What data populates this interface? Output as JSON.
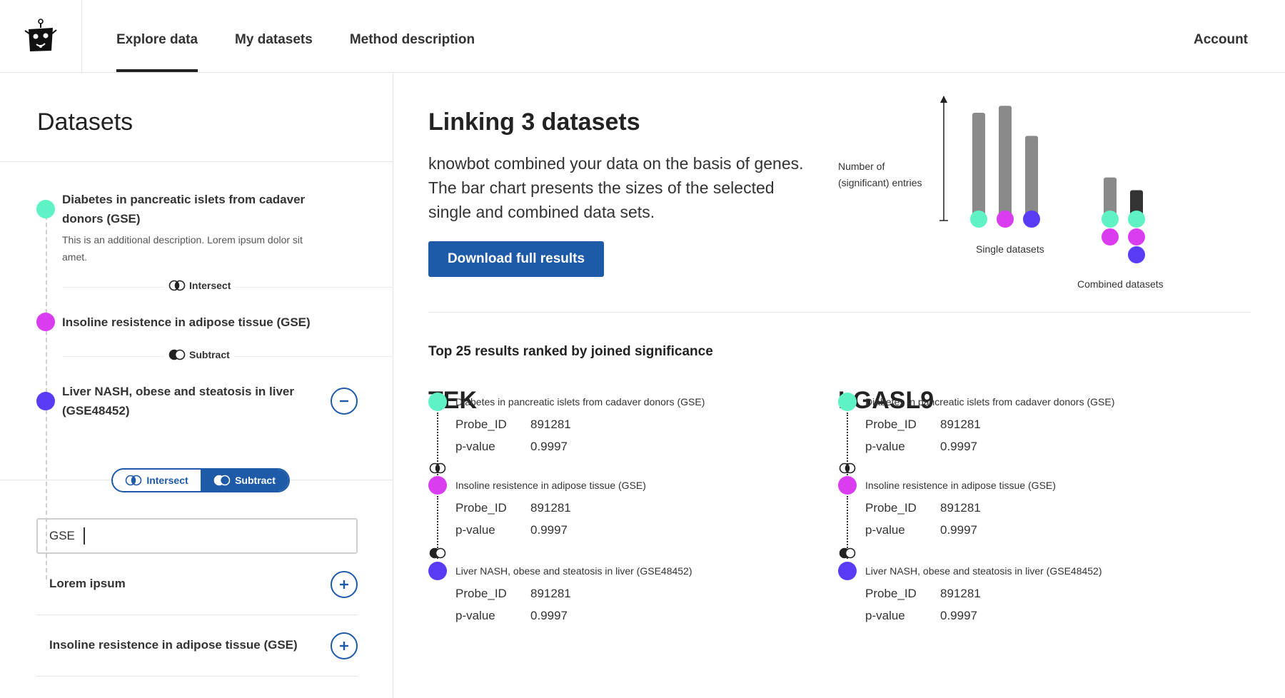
{
  "colors": {
    "teal": "#5ef2c4",
    "magenta": "#da3cf0",
    "violet": "#5a3cf6",
    "accent_blue": "#1d5aa8",
    "bar_gray": "#8a8a8a",
    "bar_dark": "#333333"
  },
  "header": {
    "logo_icon": "robot-logo-icon",
    "nav": [
      {
        "label": "Explore data",
        "active": true
      },
      {
        "label": "My datasets",
        "active": false
      },
      {
        "label": "Method description",
        "active": false
      }
    ],
    "account_label": "Account"
  },
  "left": {
    "title": "Datasets",
    "datasets": [
      {
        "title_line1": "Diabetes in pancreatic islets from cadaver",
        "title_line2": "donors (GSE)",
        "desc_line1": "This is an additional description. Lorem ipsum dolor sit",
        "desc_line2": "amet."
      },
      {
        "title_line1": "Insoline resistence in adipose tissue (GSE)"
      },
      {
        "title_line1": "Liver NASH, obese and steatosis in liver",
        "title_line2": "(GSE48452)"
      }
    ],
    "operations": [
      "Intersect",
      "Subtract"
    ],
    "toggle": {
      "intersect": "Intersect",
      "subtract": "Subtract"
    },
    "search": {
      "value": "GSE"
    },
    "results": [
      "Lorem ipsum",
      "Insoline resistence in adipose tissue (GSE)"
    ]
  },
  "main": {
    "title": "Linking 3 datasets",
    "description": "knowbot combined your data on the basis of genes. The bar chart presents the sizes of the selected single and combined data sets.",
    "download_label": "Download full results",
    "top_results_label": "Top 25 results ranked by joined significance"
  },
  "chart_data": {
    "type": "bar",
    "ylabel_line1": "Number of",
    "ylabel_line2": "(significant) entries",
    "groups": [
      {
        "label": "Single datasets",
        "bars": [
          {
            "value": 0.92,
            "datasets": [
              "teal"
            ]
          },
          {
            "value": 0.98,
            "datasets": [
              "magenta"
            ]
          },
          {
            "value": 0.72,
            "datasets": [
              "violet"
            ]
          }
        ]
      },
      {
        "label": "Combined datasets",
        "bars": [
          {
            "value": 0.36,
            "datasets": [
              "teal",
              "magenta"
            ]
          },
          {
            "value": 0.25,
            "datasets": [
              "teal",
              "magenta",
              "violet"
            ]
          }
        ]
      }
    ]
  },
  "genes": [
    {
      "name": "TEK",
      "entries": [
        {
          "dataset": "Diabetes in pancreatic islets from cadaver donors (GSE)",
          "probe_label": "Probe_ID",
          "probe": "891281",
          "pval_label": "p-value",
          "pval": "0.9997",
          "op_icon": "intersect-icon"
        },
        {
          "dataset": "Insoline resistence in adipose tissue (GSE)",
          "probe_label": "Probe_ID",
          "probe": "891281",
          "pval_label": "p-value",
          "pval": "0.9997",
          "op_icon": "subtract-icon"
        },
        {
          "dataset": "Liver NASH, obese and steatosis in liver (GSE48452)",
          "probe_label": "Probe_ID",
          "probe": "891281",
          "pval_label": "p-value",
          "pval": "0.9997"
        }
      ]
    },
    {
      "name": "LGASL9",
      "entries": [
        {
          "dataset": "Diabetes in pancreatic islets from cadaver donors (GSE)",
          "probe_label": "Probe_ID",
          "probe": "891281",
          "pval_label": "p-value",
          "pval": "0.9997",
          "op_icon": "intersect-icon"
        },
        {
          "dataset": "Insoline resistence in adipose tissue (GSE)",
          "probe_label": "Probe_ID",
          "probe": "891281",
          "pval_label": "p-value",
          "pval": "0.9997",
          "op_icon": "subtract-icon"
        },
        {
          "dataset": "Liver NASH, obese and steatosis in liver (GSE48452)",
          "probe_label": "Probe_ID",
          "probe": "891281",
          "pval_label": "p-value",
          "pval": "0.9997"
        }
      ]
    }
  ]
}
